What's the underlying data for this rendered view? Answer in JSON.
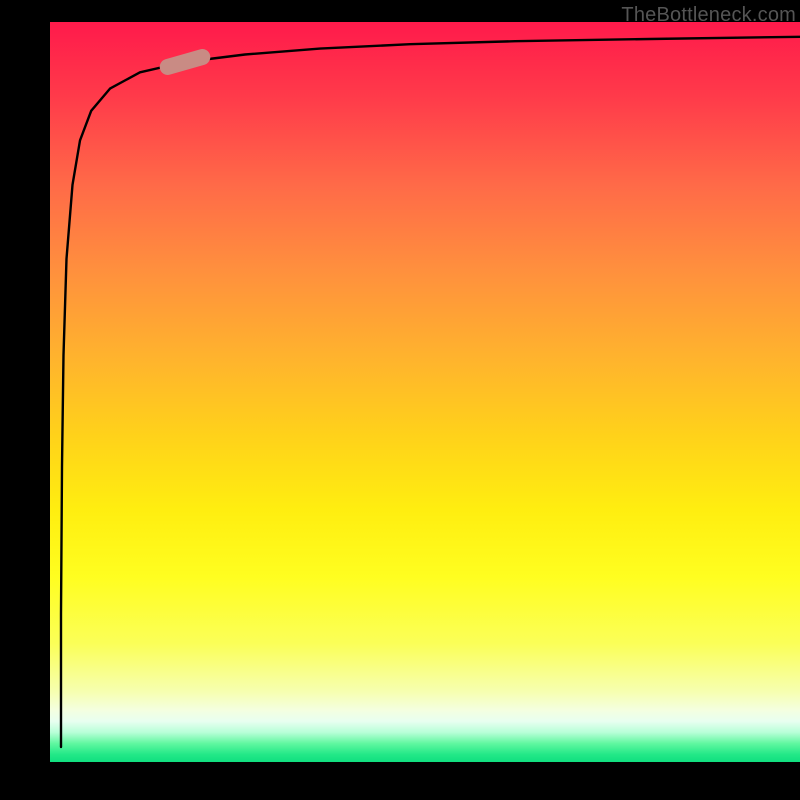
{
  "attribution": "TheBottleneck.com",
  "colors": {
    "background": "#000000",
    "curve": "#000000",
    "marker_fill": "#c98b84",
    "gradient_top": "#ff1a4b",
    "gradient_bottom": "#10df80"
  },
  "chart_data": {
    "type": "line",
    "title": "",
    "xlabel": "",
    "ylabel": "",
    "xlim": [
      0,
      100
    ],
    "ylim": [
      0,
      100
    ],
    "grid": false,
    "legend": false,
    "series": [
      {
        "name": "curve",
        "x": [
          1.5,
          1.5,
          1.6,
          1.8,
          2.2,
          3,
          4,
          5.5,
          8,
          12,
          18,
          26,
          36,
          48,
          62,
          80,
          100
        ],
        "y": [
          2,
          20,
          40,
          55,
          68,
          78,
          84,
          88,
          91,
          93.2,
          94.6,
          95.6,
          96.4,
          97,
          97.4,
          97.7,
          98
        ]
      }
    ],
    "marker": {
      "on_series": "curve",
      "x": 18,
      "y": 94.6,
      "shape": "pill"
    },
    "background_gradient": {
      "direction": "vertical",
      "stops": [
        "red",
        "orange",
        "yellow",
        "green"
      ]
    }
  }
}
